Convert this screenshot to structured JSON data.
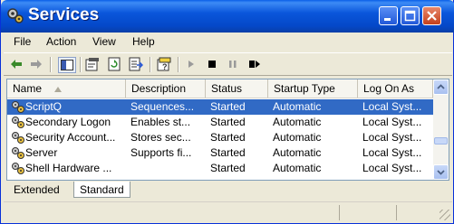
{
  "window": {
    "title": "Services"
  },
  "title_buttons": {
    "minimize": "minimize",
    "maximize": "maximize",
    "close": "close"
  },
  "menu": [
    "File",
    "Action",
    "View",
    "Help"
  ],
  "columns": [
    "Name",
    "Description",
    "Status",
    "Startup Type",
    "Log On As"
  ],
  "rows": [
    {
      "name": "ScriptQ",
      "description": "Sequences...",
      "status": "Started",
      "startup": "Automatic",
      "logon": "Local Syst..."
    },
    {
      "name": "Secondary Logon",
      "description": "Enables st...",
      "status": "Started",
      "startup": "Automatic",
      "logon": "Local Syst..."
    },
    {
      "name": "Security Account...",
      "description": "Stores sec...",
      "status": "Started",
      "startup": "Automatic",
      "logon": "Local Syst..."
    },
    {
      "name": "Server",
      "description": "Supports fi...",
      "status": "Started",
      "startup": "Automatic",
      "logon": "Local Syst..."
    },
    {
      "name": "Shell Hardware ...",
      "description": "",
      "status": "Started",
      "startup": "Automatic",
      "logon": "Local Syst..."
    }
  ],
  "tabs": [
    "Extended",
    "Standard"
  ],
  "colors": {
    "selection": "#316ac5",
    "titlebar": "#0a56db"
  }
}
